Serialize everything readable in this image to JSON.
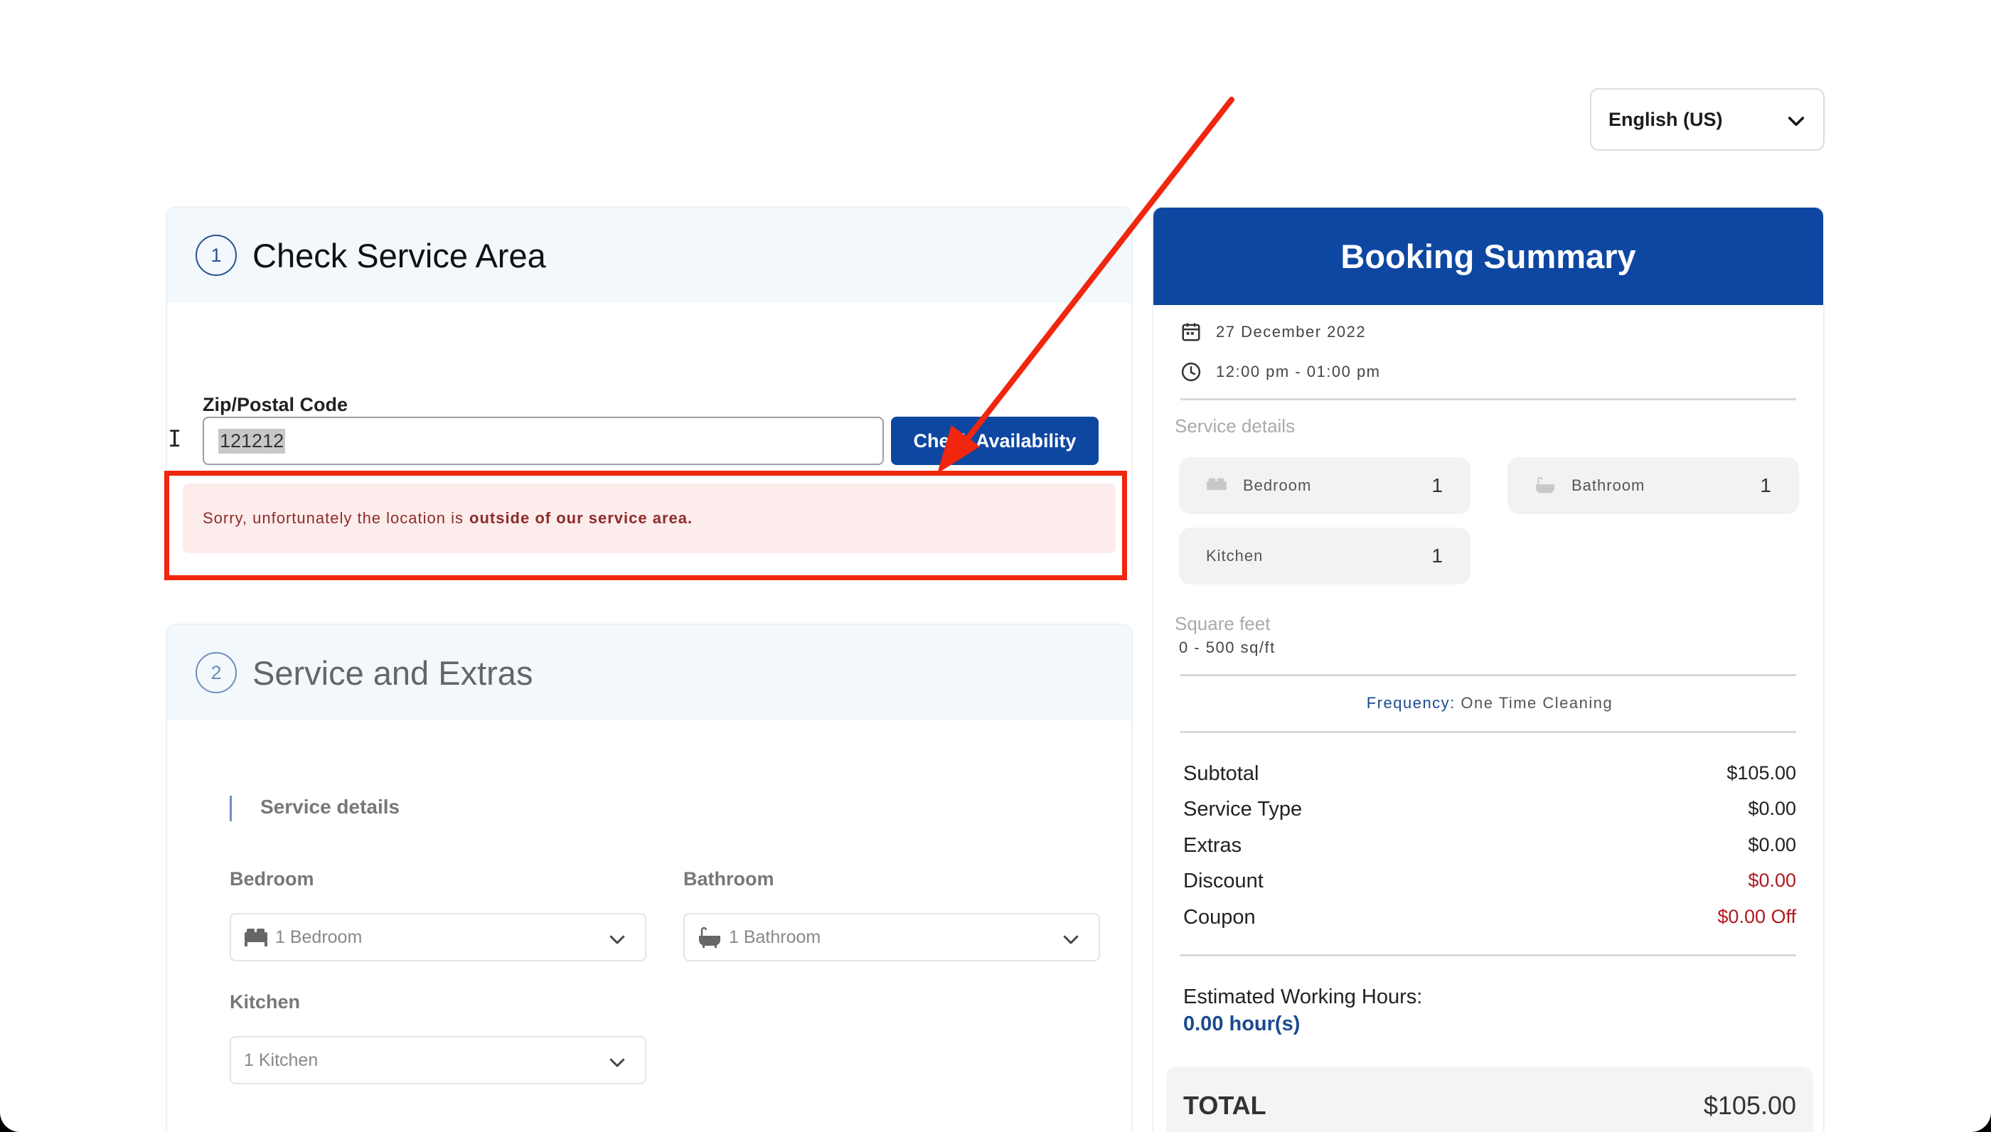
{
  "language": {
    "selected": "English (US)"
  },
  "section1": {
    "number": "1",
    "title": "Check Service Area",
    "zip_label": "Zip/Postal Code",
    "zip_value": "121212",
    "check_button": "Check Availability",
    "error_prefix": "Sorry, unfortunately the location is",
    "error_bold": "outside of our service area."
  },
  "section2": {
    "number": "2",
    "title": "Service and Extras",
    "details_heading": "Service details",
    "bedroom_label": "Bedroom",
    "bedroom_value": "1 Bedroom",
    "bathroom_label": "Bathroom",
    "bathroom_value": "1 Bathroom",
    "kitchen_label": "Kitchen",
    "kitchen_value": "1 Kitchen"
  },
  "summary": {
    "title": "Booking Summary",
    "date": "27 December 2022",
    "time": "12:00 pm - 01:00 pm",
    "service_details_label": "Service details",
    "items": [
      {
        "name": "Bedroom",
        "count": "1"
      },
      {
        "name": "Bathroom",
        "count": "1"
      },
      {
        "name": "Kitchen",
        "count": "1"
      }
    ],
    "sqft_label": "Square feet",
    "sqft_value": "0 - 500 sq/ft",
    "frequency_label": "Frequency:",
    "frequency_value": "One Time Cleaning",
    "prices": [
      {
        "label": "Subtotal",
        "value": "$105.00"
      },
      {
        "label": "Service Type",
        "value": "$0.00"
      },
      {
        "label": "Extras",
        "value": "$0.00"
      },
      {
        "label": "Discount",
        "value": "$0.00"
      },
      {
        "label": "Coupon",
        "value": "$0.00 Off"
      }
    ],
    "est_label": "Estimated Working Hours:",
    "est_value": "0.00 hour(s)",
    "total_label": "TOTAL",
    "total_value": "$105.00"
  },
  "colors": {
    "primary": "#0e47a1",
    "error_bg": "#fdecec",
    "error_text": "#8e2b2b",
    "annotation": "#f0260f",
    "negative": "#b0191e"
  }
}
